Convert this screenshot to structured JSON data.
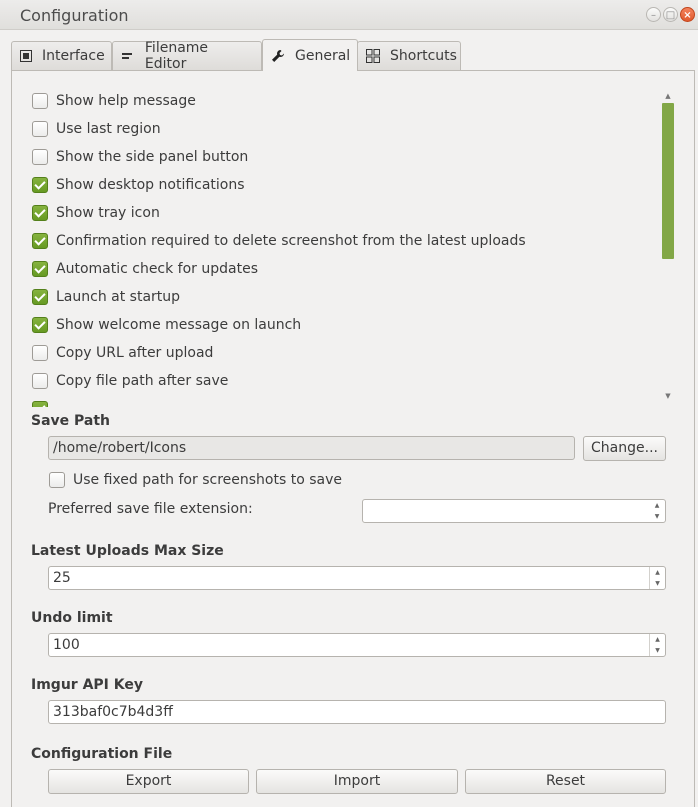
{
  "window": {
    "title": "Configuration"
  },
  "tabs": [
    {
      "label": "Interface",
      "icon": "interface-icon"
    },
    {
      "label": "Filename Editor",
      "icon": "filename-icon"
    },
    {
      "label": "General",
      "icon": "wrench-icon",
      "active": true
    },
    {
      "label": "Shortcuts",
      "icon": "grid-icon"
    }
  ],
  "options": [
    {
      "label": "Show help message",
      "checked": false
    },
    {
      "label": "Use last region",
      "checked": false
    },
    {
      "label": "Show the side panel button",
      "checked": false
    },
    {
      "label": "Show desktop notifications",
      "checked": true
    },
    {
      "label": "Show tray icon",
      "checked": true
    },
    {
      "label": "Confirmation required to delete screenshot from the latest uploads",
      "checked": true
    },
    {
      "label": "Automatic check for updates",
      "checked": true
    },
    {
      "label": "Launch at startup",
      "checked": true
    },
    {
      "label": "Show welcome message on launch",
      "checked": true
    },
    {
      "label": "Copy URL after upload",
      "checked": false
    },
    {
      "label": "Copy file path after save",
      "checked": false
    },
    {
      "label": "",
      "checked": true
    }
  ],
  "save_path": {
    "heading": "Save Path",
    "value": "/home/robert/Icons",
    "change_label": "Change...",
    "fixed_path_label": "Use fixed path for screenshots to save",
    "fixed_path_checked": false,
    "extension_label": "Preferred save file extension:",
    "extension_value": ""
  },
  "uploads": {
    "heading": "Latest Uploads Max Size",
    "value": "25"
  },
  "undo": {
    "heading": "Undo limit",
    "value": "100"
  },
  "imgur": {
    "heading": "Imgur API Key",
    "value": "313baf0c7b4d3ff"
  },
  "config_file": {
    "heading": "Configuration File",
    "export_label": "Export",
    "import_label": "Import",
    "reset_label": "Reset"
  },
  "colors": {
    "accent": "#76a032",
    "close": "#e0592e"
  }
}
